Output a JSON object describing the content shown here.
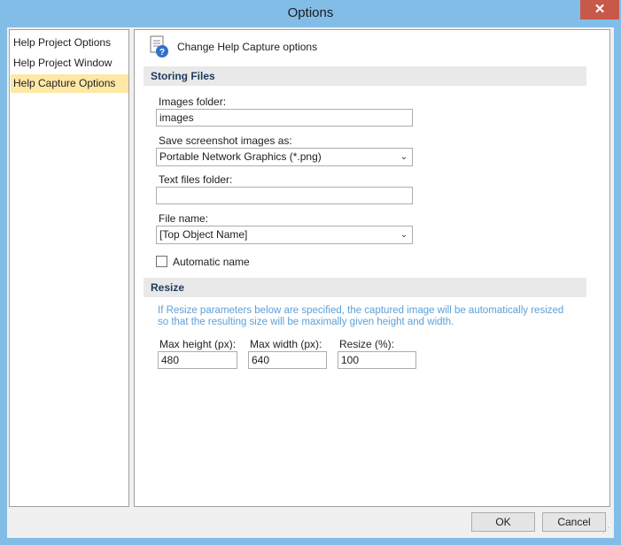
{
  "window": {
    "title": "Options",
    "close_glyph": "✕"
  },
  "nav": {
    "items": [
      {
        "label": "Help Project Options"
      },
      {
        "label": "Help Project Window"
      },
      {
        "label": "Help Capture Options"
      }
    ]
  },
  "panel": {
    "header": "Change Help Capture options",
    "storing": {
      "title": "Storing  Files",
      "images_folder_label": "Images folder:",
      "images_folder_value": "images",
      "save_as_label": "Save screenshot images as:",
      "save_as_value": "Portable Network Graphics (*.png)",
      "text_folder_label": "Text files folder:",
      "text_folder_value": "",
      "file_name_label": "File name:",
      "file_name_value": "[Top Object Name]",
      "automatic_name_label": "Automatic name"
    },
    "resize": {
      "title": "Resize",
      "note_line1": "If Resize parameters below are specified, the captured image will be automatically resized",
      "note_line2": "so that the resulting size will be maximally given height and width.",
      "max_height_label": "Max height (px):",
      "max_height_value": "480",
      "max_width_label": "Max width (px):",
      "max_width_value": "640",
      "resize_label": "Resize (%):",
      "resize_value": "100"
    }
  },
  "buttons": {
    "ok": "OK",
    "cancel": "Cancel"
  },
  "colors": {
    "titlebar": "#82bde8",
    "close": "#c8584a",
    "selected_nav": "#ffe8a6",
    "note": "#5ea0d8",
    "section_title": "#1e3a5c"
  }
}
